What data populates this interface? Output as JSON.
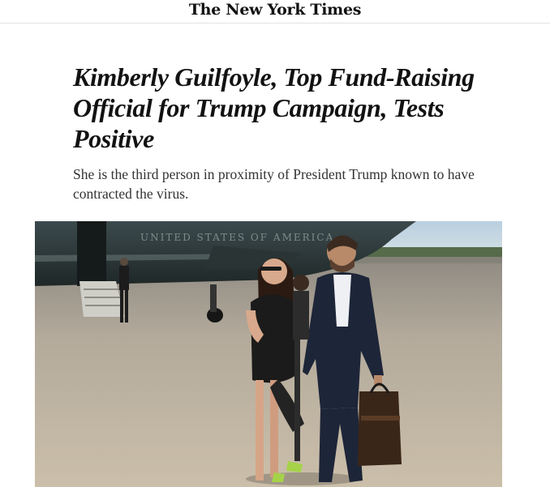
{
  "masthead": {
    "logo_text": "The New York Times"
  },
  "article": {
    "headline": "Kimberly Guilfoyle, Top Fund-Raising Official for Trump Campaign, Tests Positive",
    "summary": "She is the third person in proximity of President Trump known to have contracted the virus."
  },
  "photo": {
    "plane_text": "UNITED STATES OF AMERICA"
  }
}
